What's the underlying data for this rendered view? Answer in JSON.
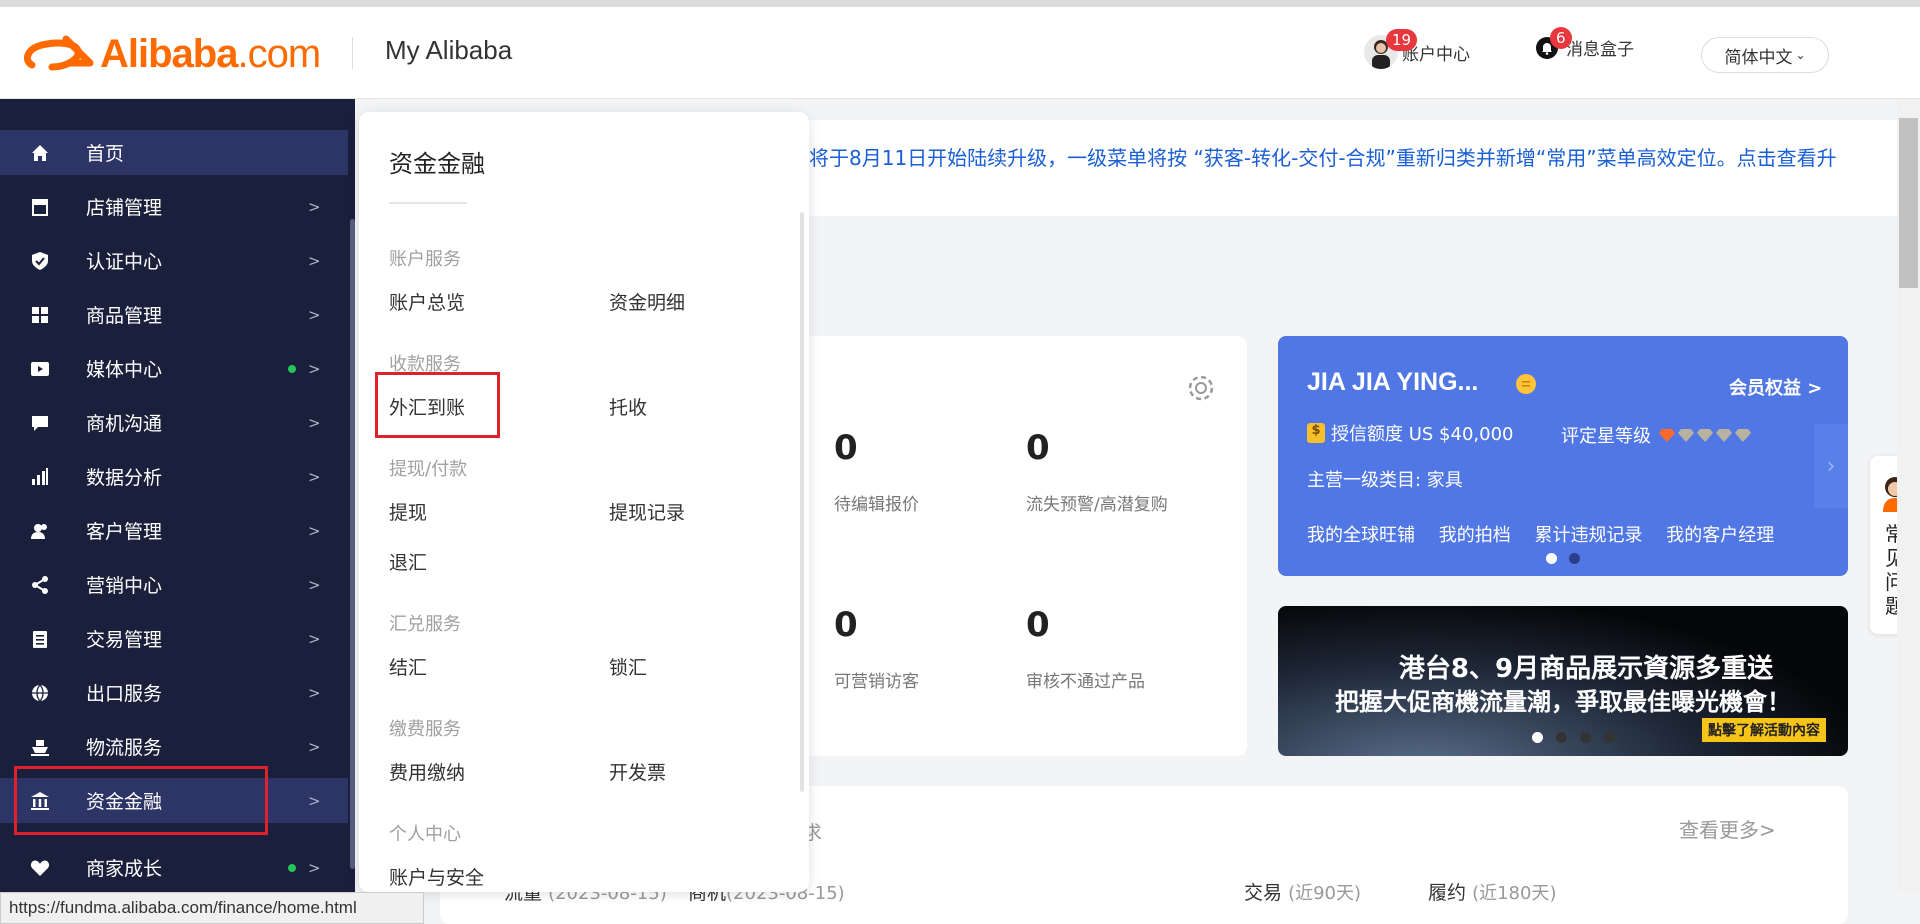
{
  "header": {
    "logo_text": "Alibaba",
    "logo_domain": ".com",
    "section_title": "My Alibaba",
    "account_badge": "19",
    "account_label": "账户中心",
    "message_badge": "6",
    "message_label": "消息盒子",
    "language": "简体中文"
  },
  "sidebar": {
    "items": [
      {
        "label": "首页",
        "icon": "home-icon"
      },
      {
        "label": "店铺管理",
        "icon": "store-icon",
        "arrow": ">"
      },
      {
        "label": "认证中心",
        "icon": "shield-icon",
        "arrow": ">"
      },
      {
        "label": "商品管理",
        "icon": "grid-icon",
        "arrow": ">"
      },
      {
        "label": "媒体中心",
        "icon": "video-icon",
        "arrow": ">"
      },
      {
        "label": "商机沟通",
        "icon": "chat-icon",
        "arrow": ">"
      },
      {
        "label": "数据分析",
        "icon": "bar-chart-icon",
        "arrow": ">"
      },
      {
        "label": "客户管理",
        "icon": "users-icon",
        "arrow": ">"
      },
      {
        "label": "营销中心",
        "icon": "share-icon",
        "arrow": ">"
      },
      {
        "label": "交易管理",
        "icon": "clipboard-icon",
        "arrow": ">"
      },
      {
        "label": "出口服务",
        "icon": "globe-icon",
        "arrow": ">"
      },
      {
        "label": "物流服务",
        "icon": "ship-icon",
        "arrow": ">"
      },
      {
        "label": "资金金融",
        "icon": "bank-icon",
        "arrow": ">"
      },
      {
        "label": "商家成长",
        "icon": "heart-icon",
        "arrow": ">"
      }
    ]
  },
  "flyout": {
    "title": "资金金融",
    "sections": [
      {
        "title": "账户服务",
        "links": [
          "账户总览",
          "资金明细"
        ]
      },
      {
        "title": "收款服务",
        "links": [
          "外汇到账",
          "托收"
        ]
      },
      {
        "title": "提现/付款",
        "links": [
          "提现",
          "提现记录",
          "退汇"
        ]
      },
      {
        "title": "汇兑服务",
        "links": [
          "结汇",
          "锁汇"
        ]
      },
      {
        "title": "缴费服务",
        "links": [
          "费用缴纳",
          "开发票"
        ]
      },
      {
        "title": "个人中心",
        "links": [
          "账户与安全"
        ]
      }
    ]
  },
  "notice": {
    "text": "将于8月11日开始陆续升级，一级菜单将按 “获客-转化-交付-合规”重新归类并新增“常用”菜单高效定位。点击查看升"
  },
  "stats": [
    {
      "value": "0",
      "label": "待编辑报价"
    },
    {
      "value": "0",
      "label": "流失预警/高潜复购"
    },
    {
      "value": "0",
      "label": "可营销访客"
    },
    {
      "value": "0",
      "label": "审核不通过产品"
    }
  ],
  "member": {
    "name": "JIA JIA YING...",
    "rights": "会员权益 >",
    "credit": "授信额度 US $40,000",
    "rating_label": "评定星等级",
    "rating": 1,
    "rating_max": 5,
    "category": "主营一级类目: 家具",
    "links": [
      "我的全球旺铺",
      "我的拍档",
      "累计违规记录",
      "我的客户经理"
    ]
  },
  "banner": {
    "line1": "港台8、9月商品展示資源多重送",
    "line2": "把握大促商機流量潮，爭取最佳曝光機會！",
    "cta": "點擊了解活動內容"
  },
  "bottom": {
    "more": "查看更多>",
    "frag_left": "流量",
    "frag_left_date": "(2023-08-15)",
    "frag_mid": "商机",
    "frag_mid_date": "(2023-08-15)",
    "trade": "交易",
    "trade_note": "(近90天)",
    "fulfill": "履约",
    "fulfill_note": "(近180天)",
    "frag_char": "求"
  },
  "faq": {
    "label": "常见问题"
  },
  "statusbar": {
    "url": "https://fundma.alibaba.com/finance/home.html"
  },
  "colors": {
    "brand": "#ff6a00",
    "sidebar_bg": "#1a1f3c",
    "member_bg": "#5077e4",
    "highlight": "#e0202a"
  }
}
